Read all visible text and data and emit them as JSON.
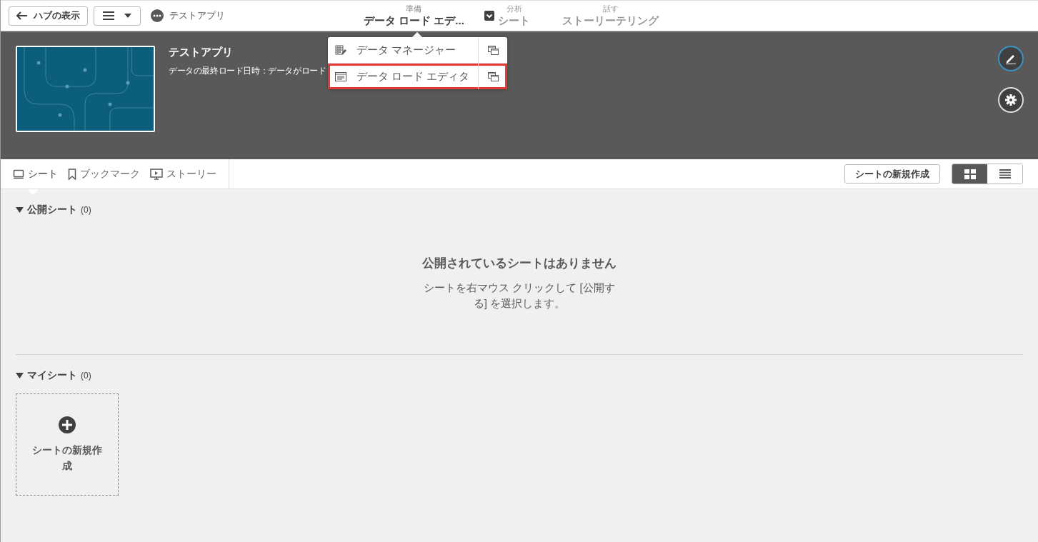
{
  "topbar": {
    "back_button": "ハブの表示",
    "app_name": "テストアプリ",
    "nav": [
      {
        "caption": "準備",
        "label": "データ ロード エデ...",
        "selected": true,
        "has_dropdown": true
      },
      {
        "caption": "分析",
        "label": "シート",
        "selected": false,
        "has_dropdown": false
      },
      {
        "caption": "話す",
        "label": "ストーリーテリング",
        "selected": false,
        "has_dropdown": false
      }
    ]
  },
  "dropdown": {
    "items": [
      {
        "kind": "manager",
        "label": "データ マネージャー",
        "highlighted": false
      },
      {
        "kind": "editor",
        "label": "データ ロード エディタ",
        "highlighted": true
      }
    ]
  },
  "header": {
    "title": "テストアプリ",
    "subtitle": "データの最終ロード日時：データがロード"
  },
  "tabs": [
    {
      "kind": "sheet",
      "label": "シート",
      "selected": true
    },
    {
      "kind": "bookmark",
      "label": "ブックマーク",
      "selected": false
    },
    {
      "kind": "story",
      "label": "ストーリー",
      "selected": false
    }
  ],
  "new_sheet_button": "シートの新規作成",
  "view_modes": [
    {
      "kind": "grid",
      "selected": true
    },
    {
      "kind": "list",
      "selected": false
    }
  ],
  "sections": [
    {
      "title": "公開シート",
      "count": "(0)",
      "expanded": true,
      "empty_title": "公開されているシートはありません",
      "empty_text": "シートを右マウス クリックして [公開する] を選択します。"
    },
    {
      "title": "マイシート",
      "count": "(0)",
      "expanded": true,
      "add_card": "シートの新規作成"
    }
  ]
}
